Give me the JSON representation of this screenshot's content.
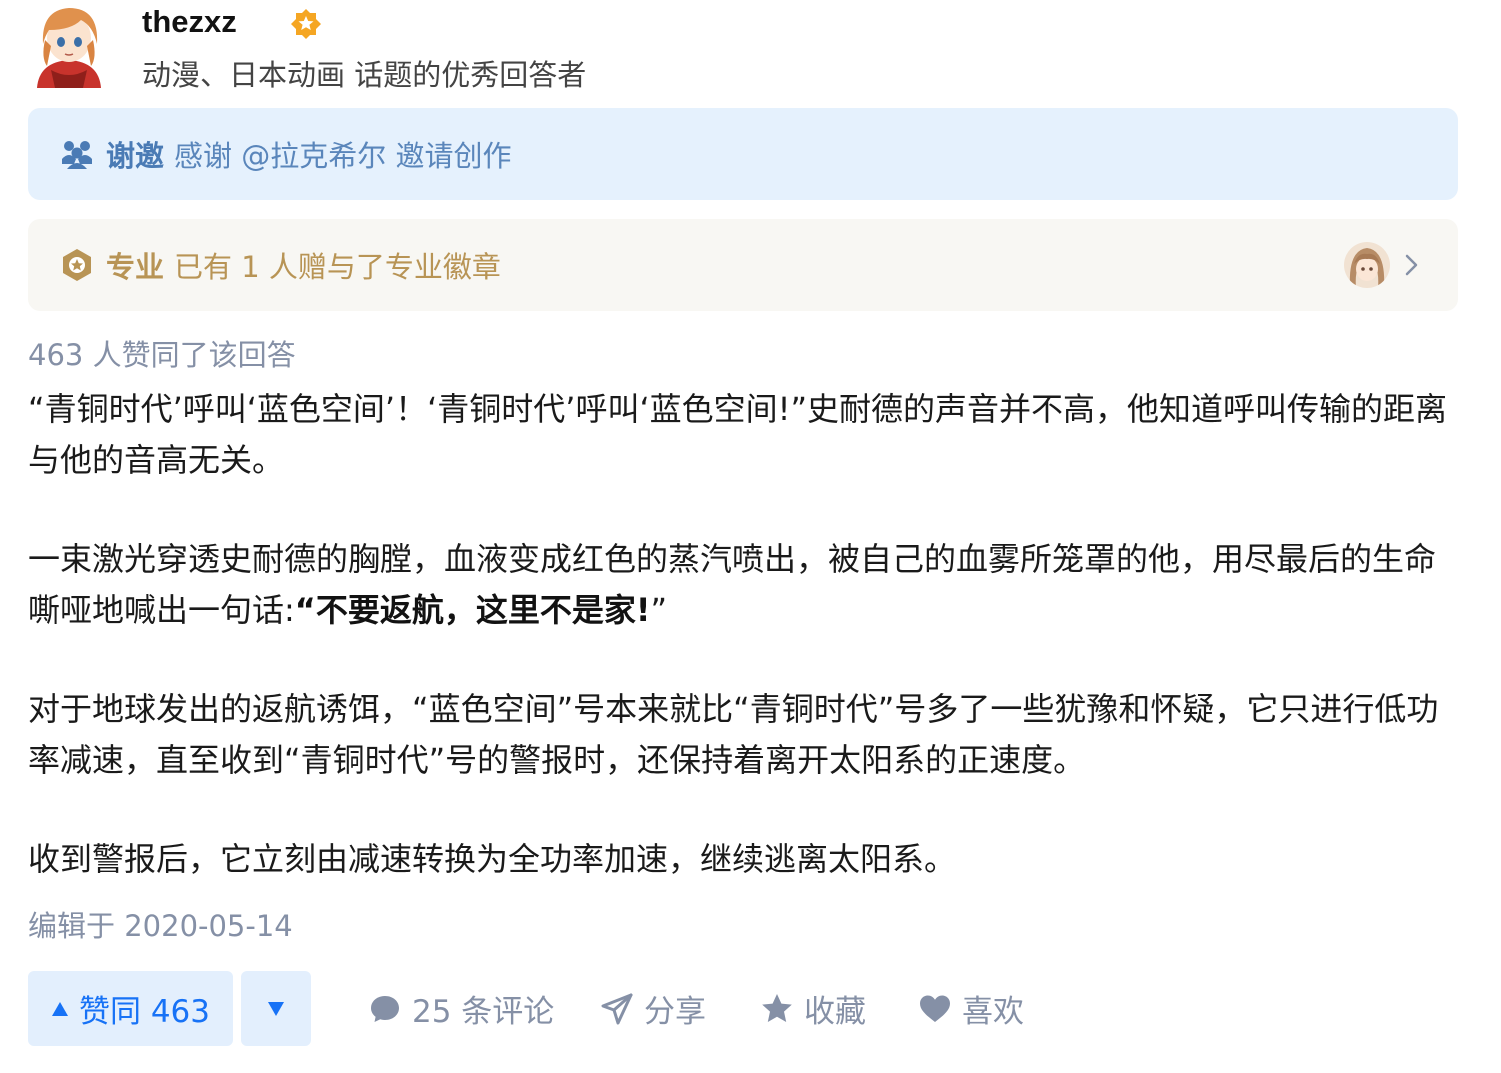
{
  "author": {
    "name": "thezxz",
    "description": "动漫、日本动画 话题的优秀回答者"
  },
  "invite_card": {
    "tag": "谢邀",
    "text": "感谢 @拉克希尔 邀请创作"
  },
  "pro_card": {
    "tag": "专业",
    "text": "已有 1 人赠与了专业徽章"
  },
  "votes_summary": "463 人赞同了该回答",
  "content": {
    "p1": "“青铜时代’呼叫‘蓝色空间’！‘青铜时代’呼叫‘蓝色空间!”史耐德的声音并不高，他知道呼叫传输的距离与他的音高无关。",
    "p2_prefix": "一束激光穿透史耐德的胸膛，血液变成红色的蒸汽喷出，被自己的血雾所笼罩的他，用尽最后的生命嘶哑地喊出一句话:",
    "p2_quote_open": "“",
    "p2_bold": "不要返航，这里不是家!",
    "p2_quote_close": "”",
    "p3": "对于地球发出的返航诱饵，“蓝色空间”号本来就比“青铜时代”号多了一些犹豫和怀疑，它只进行低功率减速，直至收到“青铜时代”号的警报时，还保持着离开太阳系的正速度。",
    "p4": "收到警报后，它立刻由减速转换为全功率加速，继续逃离太阳系。"
  },
  "edited": "编辑于 2020-05-14",
  "actions": {
    "vote_up_label": "赞同 463",
    "comments_label": "25 条评论",
    "share_label": "分享",
    "collect_label": "收藏",
    "like_label": "喜欢"
  },
  "colors": {
    "accent": "#1772f6",
    "muted": "#8590a6",
    "invite_bg": "#e5f1fd",
    "pro_bg": "#f8f7f3",
    "verified": "#f5a623",
    "pro_gold": "#b89455"
  }
}
